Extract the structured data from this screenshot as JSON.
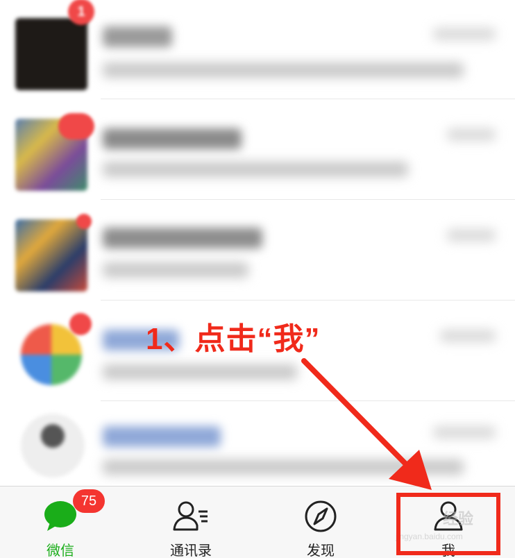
{
  "tab_bar": {
    "tabs": [
      {
        "id": "chats",
        "label": "微信",
        "icon": "chat-bubble-icon",
        "badge": "75",
        "active": true
      },
      {
        "id": "contacts",
        "label": "通讯录",
        "icon": "contacts-icon",
        "active": false
      },
      {
        "id": "discover",
        "label": "发现",
        "icon": "compass-icon",
        "active": false
      },
      {
        "id": "me",
        "label": "我",
        "icon": "person-icon",
        "active": false
      }
    ]
  },
  "chat_list": {
    "first_row_badge": "1",
    "row_count_visible": 5,
    "note": ""
  },
  "annotation": {
    "callout_text": "1、点击“我”",
    "color": "#f02a1b"
  },
  "watermark": {
    "main": "经验",
    "sub": "jingyan.baidu.com"
  },
  "colors": {
    "accent_green": "#1aad19",
    "badge_red": "#f43530",
    "annotation_red": "#f02a1b"
  }
}
